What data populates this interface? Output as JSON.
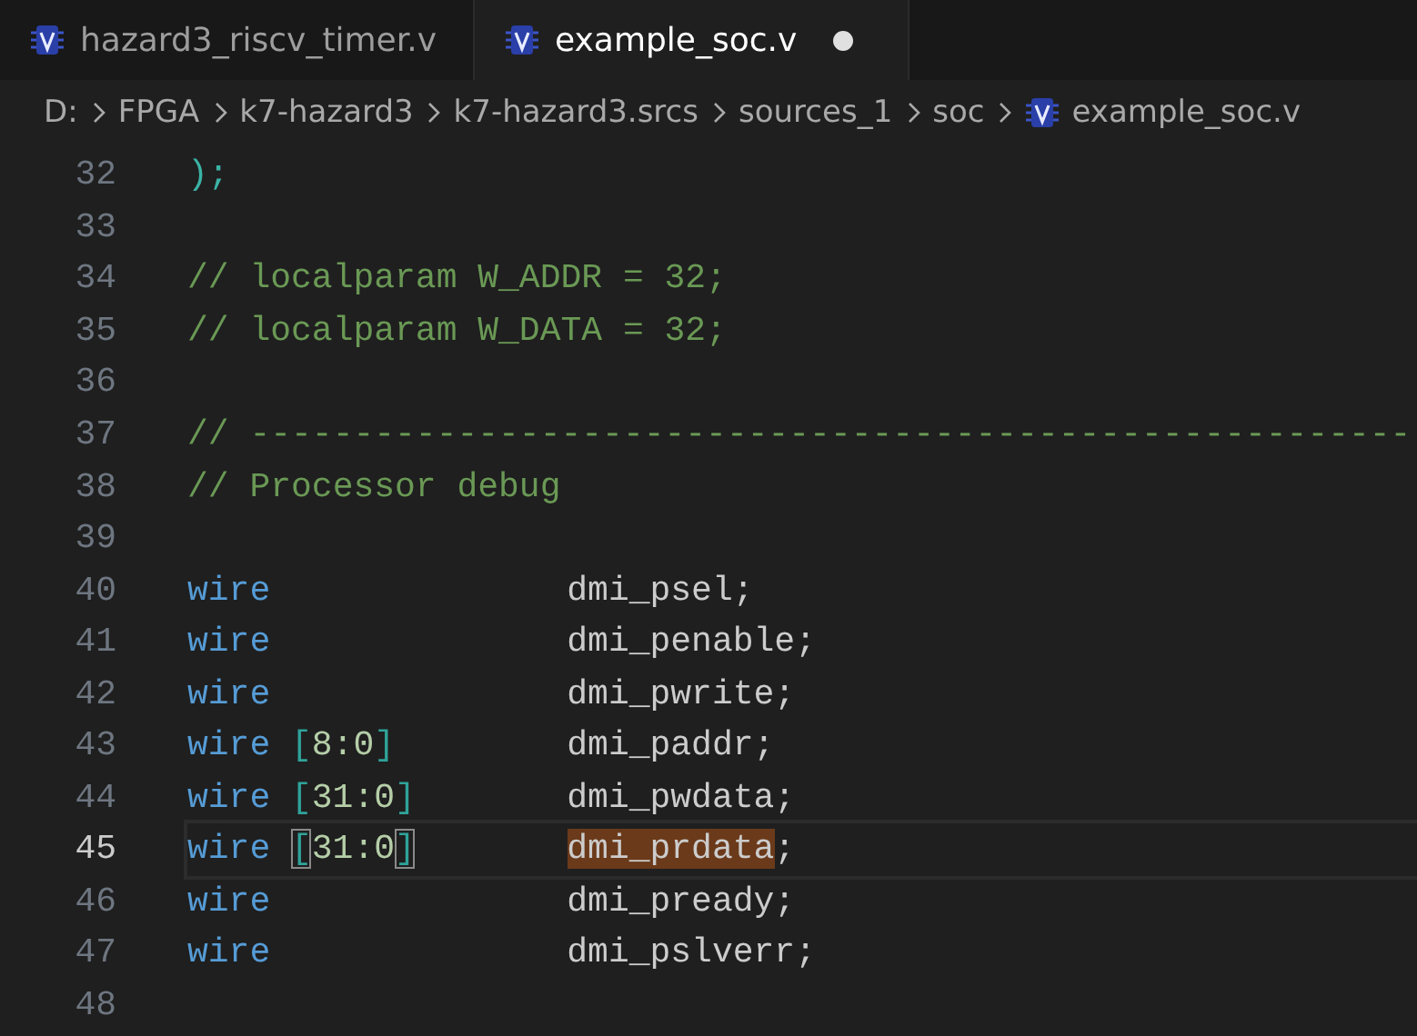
{
  "tabs": [
    {
      "label": "hazard3_riscv_timer.v",
      "selected": false,
      "modified": false
    },
    {
      "label": "example_soc.v",
      "selected": true,
      "modified": true
    }
  ],
  "breadcrumb": [
    {
      "label": "D:",
      "file": false
    },
    {
      "label": "FPGA",
      "file": false
    },
    {
      "label": "k7-hazard3",
      "file": false
    },
    {
      "label": "k7-hazard3.srcs",
      "file": false
    },
    {
      "label": "sources_1",
      "file": false
    },
    {
      "label": "soc",
      "file": false
    },
    {
      "label": "example_soc.v",
      "file": true
    }
  ],
  "lines": [
    {
      "number": "32",
      "current": false,
      "kind": "punct",
      "text": ");"
    },
    {
      "number": "33",
      "current": false,
      "kind": "blank"
    },
    {
      "number": "34",
      "current": false,
      "kind": "comment",
      "text": "// localparam W_ADDR = 32;"
    },
    {
      "number": "35",
      "current": false,
      "kind": "comment",
      "text": "// localparam W_DATA = 32;"
    },
    {
      "number": "36",
      "current": false,
      "kind": "blank"
    },
    {
      "number": "37",
      "current": false,
      "kind": "comment",
      "text": "// --------------------------------------------------------"
    },
    {
      "number": "38",
      "current": false,
      "kind": "comment",
      "text": "// Processor debug"
    },
    {
      "number": "39",
      "current": false,
      "kind": "blank"
    },
    {
      "number": "40",
      "current": false,
      "kind": "decl",
      "keyword": "wire",
      "name": "dmi_psel",
      "end": ";",
      "highlighted": false
    },
    {
      "number": "41",
      "current": false,
      "kind": "decl",
      "keyword": "wire",
      "name": "dmi_penable",
      "end": ";",
      "highlighted": false
    },
    {
      "number": "42",
      "current": false,
      "kind": "decl",
      "keyword": "wire",
      "name": "dmi_pwrite",
      "end": ";",
      "highlighted": false
    },
    {
      "number": "43",
      "current": false,
      "kind": "decl",
      "keyword": "wire",
      "open": "[",
      "range": "8:0",
      "close": "]",
      "bracket_match": false,
      "name": "dmi_paddr",
      "end": ";",
      "highlighted": false
    },
    {
      "number": "44",
      "current": false,
      "kind": "decl",
      "keyword": "wire",
      "open": "[",
      "range": "31:0",
      "close": "]",
      "bracket_match": false,
      "name": "dmi_pwdata",
      "end": ";",
      "highlighted": false
    },
    {
      "number": "45",
      "current": true,
      "kind": "decl",
      "keyword": "wire",
      "open": "[",
      "range": "31:0",
      "close": "]",
      "bracket_match": true,
      "name": "dmi_prdata",
      "end": ";",
      "highlighted": true
    },
    {
      "number": "46",
      "current": false,
      "kind": "decl",
      "keyword": "wire",
      "name": "dmi_pready",
      "end": ";",
      "highlighted": false
    },
    {
      "number": "47",
      "current": false,
      "kind": "decl",
      "keyword": "wire",
      "name": "dmi_pslverr",
      "end": ";",
      "highlighted": false
    },
    {
      "number": "48",
      "current": false,
      "kind": "blank"
    }
  ]
}
